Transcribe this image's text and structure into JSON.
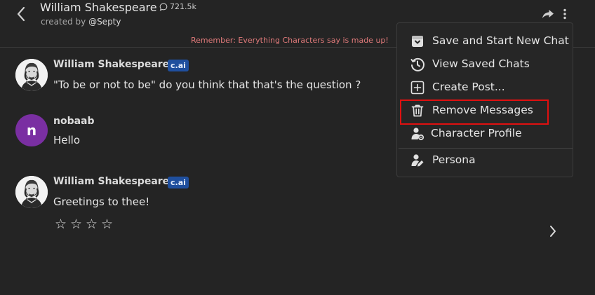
{
  "header": {
    "title": "William Shakespeare",
    "interaction_count": "721.5k",
    "created_by_prefix": "created by ",
    "creator_handle": "@Septy",
    "disclaimer": "Remember: Everything Characters say is made up!"
  },
  "messages": [
    {
      "author": "William Shakespeare",
      "badge": "c.ai",
      "text": "\"To be or not to be\" do you think that that's the question ?",
      "avatar": "shakespeare-portrait"
    },
    {
      "author": "nobaab",
      "avatar_letter": "n",
      "text": "Hello"
    },
    {
      "author": "William Shakespeare",
      "badge": "c.ai",
      "text": "Greetings to thee!",
      "avatar": "shakespeare-portrait",
      "rating_stars": [
        "☆",
        "☆",
        "☆",
        "☆"
      ]
    }
  ],
  "menu": {
    "items": [
      {
        "label": "Save and Start New Chat",
        "icon": "save-box-icon"
      },
      {
        "label": "View Saved Chats",
        "icon": "history-icon"
      },
      {
        "label": "Create Post...",
        "icon": "plus-square-icon"
      },
      {
        "label": "Remove Messages",
        "icon": "trash-icon",
        "highlighted": true
      },
      {
        "label": "Character Profile",
        "icon": "user-gear-icon"
      },
      {
        "label": "Persona",
        "icon": "user-edit-icon"
      }
    ]
  },
  "colors": {
    "background": "#242424",
    "badge": "#1f4f9e",
    "disclaimer": "#e07a7a",
    "avatar_purple": "#7a2fa2",
    "highlight": "#e01010"
  }
}
